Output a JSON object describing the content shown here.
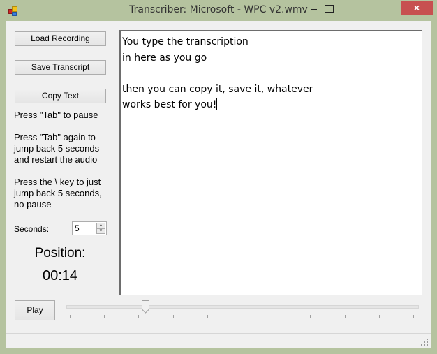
{
  "window": {
    "title": "Transcriber: Microsoft - WPC v2.wmv",
    "app_icon": "app-icon",
    "controls": {
      "minimize": "minimize-icon",
      "maximize": "maximize-icon",
      "close": "×"
    }
  },
  "sidebar": {
    "load_label": "Load Recording",
    "save_label": "Save Transcript",
    "copy_label": "Copy Text",
    "help": [
      "Press \"Tab\" to pause",
      "Press \"Tab\" again to jump back 5 seconds and restart the audio",
      "Press the \\ key to just jump back 5 seconds, no pause"
    ],
    "seconds_label": "Seconds:",
    "seconds_value": "5",
    "position_label": "Position:",
    "position_value": "00:14"
  },
  "transcript": {
    "text": "You type the transcription\nin here as you go\n\nthen you can copy it, save it, whatever\nworks best for you!"
  },
  "playback": {
    "play_label": "Play",
    "slider": {
      "min": 0,
      "max": 10,
      "value": 2.2,
      "tick_count": 11
    }
  }
}
